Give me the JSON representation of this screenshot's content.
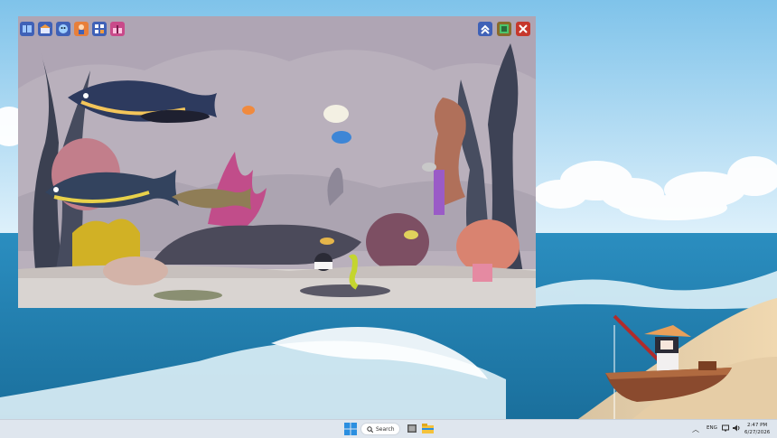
{
  "desktop": {
    "wallpaper": "ocean-beach",
    "sky_color": "#bfe3f5",
    "sea_color": "#1f7fb0"
  },
  "game": {
    "toolbar_left_icons": [
      "fish-book-icon",
      "shop-icon",
      "face-icon",
      "character-icon",
      "collection-icon",
      "gift-icon"
    ],
    "toolbar_right_icons": [
      "collapse-icon",
      "window-icon",
      "close-icon"
    ],
    "background_color": "#b7adb9"
  },
  "taskbar": {
    "search_label": "Search",
    "language": "ENG",
    "time": "2:47 PM",
    "date": "6/27/2026"
  }
}
